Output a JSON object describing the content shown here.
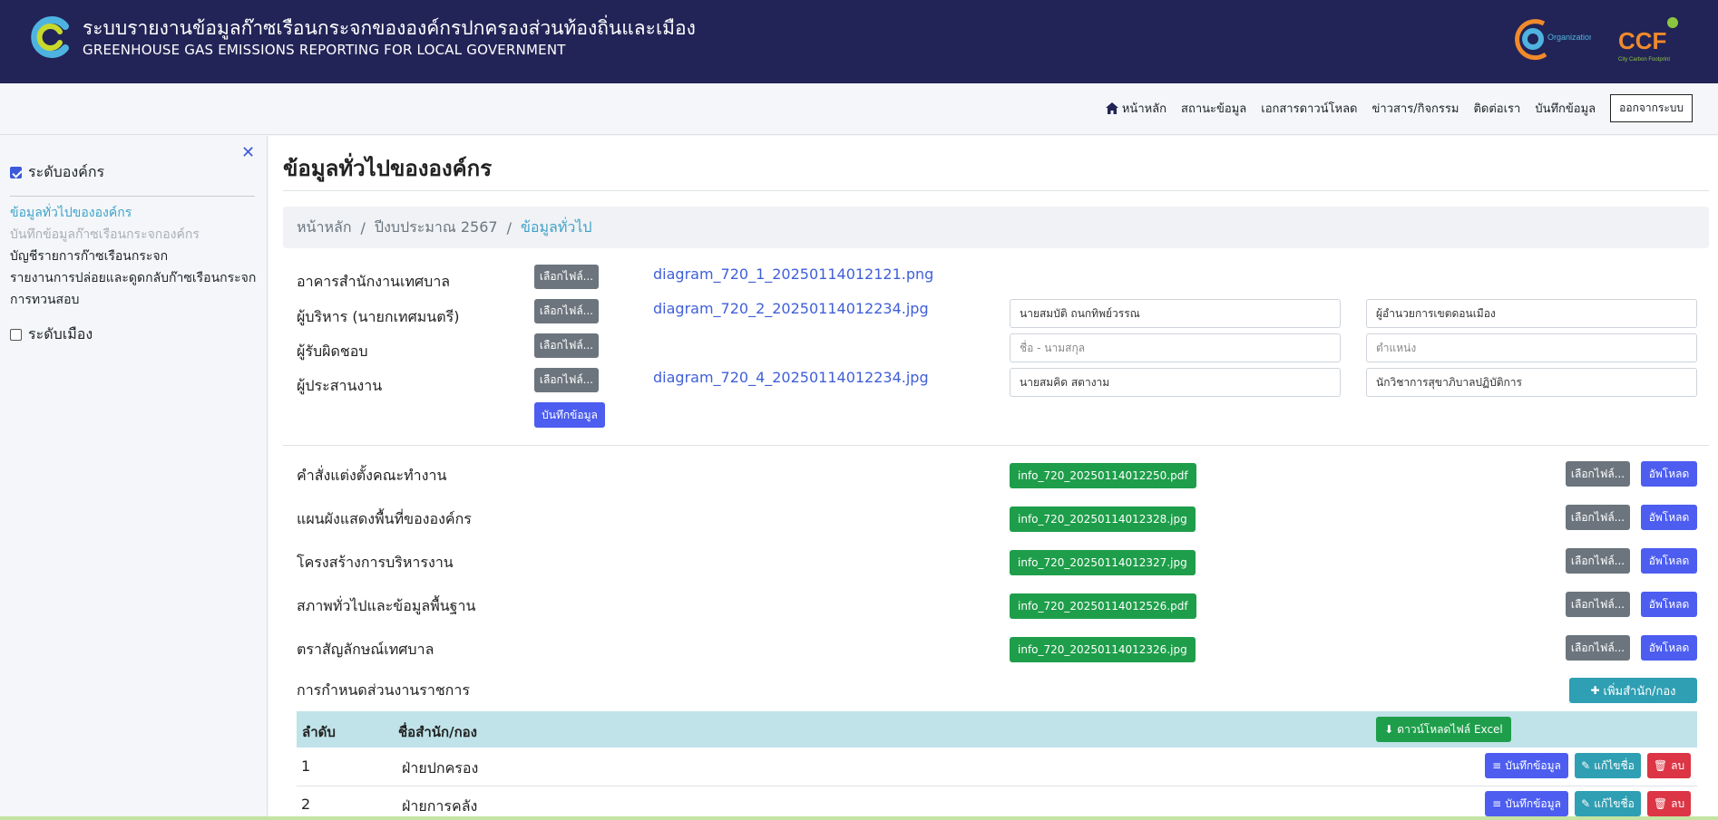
{
  "header": {
    "title_th": "ระบบรายงานข้อมูลก๊าซเรือนกระจกขององค์กรปกครองส่วนท้องถิ่นและเมือง",
    "title_en": "GREENHOUSE GAS EMISSIONS REPORTING FOR LOCAL GOVERNMENT",
    "logo_org_text": "Organization",
    "logo_ccf_text": "CCF",
    "logo_ccf_sub": "City Carbon Footprint"
  },
  "nav": {
    "home": "หน้าหลัก",
    "status": "สถานะข้อมูล",
    "downloads": "เอกสารดาวน์โหลด",
    "news": "ข่าวสาร/กิจกรรม",
    "contact": "ติดต่อเรา",
    "record": "บันทึกข้อมูล",
    "logout": "ออกจากระบบ"
  },
  "sidebar": {
    "org_level": "ระดับองค์กร",
    "city_level": "ระดับเมือง",
    "menu": [
      "ข้อมูลทั่วไปขององค์กร",
      "บันทึกข้อมูลก๊าซเรือนกระจกองค์กร",
      "บัญชีรายการก๊าซเรือนกระจก",
      "รายงานการปล่อยและดูดกลับก๊าซเรือนกระจก",
      "การทวนสอบ"
    ]
  },
  "main": {
    "title": "ข้อมูลทั่วไปขององค์กร",
    "breadcrumb": [
      "หน้าหลัก",
      "ปีงบประมาณ 2567",
      "ข้อมูลทั่วไป"
    ],
    "choose_file": "เลือกไฟล์...",
    "save": "บันทึกข้อมูล",
    "upload": "อัพโหลด",
    "images": [
      {
        "label": "อาคารสำนักงานเทศบาล",
        "file": "diagram_720_1_20250114012121.png",
        "name": "",
        "position": ""
      },
      {
        "label": "ผู้บริหาร (นายกเทศมนตรี)",
        "file": "diagram_720_2_20250114012234.jpg",
        "name": "นายสมบัติ ถนกทิพย์วรรณ",
        "position": "ผู้อำนวยการเขตดอนเมือง"
      },
      {
        "label": "ผู้รับผิดชอบ",
        "file": "",
        "name_placeholder": "ชื่อ - นามสกุล",
        "position_placeholder": "ตำแหน่ง"
      },
      {
        "label": "ผู้ประสานงาน",
        "file": "diagram_720_4_20250114012234.jpg",
        "name": "นายสมคิด สตางาม",
        "position": "นักวิชาการสุขาภิบาลปฏิบัติการ"
      }
    ],
    "docs": [
      {
        "label": "คำสั่งแต่งตั้งคณะทำงาน",
        "file": "info_720_20250114012250.pdf"
      },
      {
        "label": "แผนผังแสดงพื้นที่ขององค์กร",
        "file": "info_720_20250114012328.jpg"
      },
      {
        "label": "โครงสร้างการบริหารงาน",
        "file": "info_720_20250114012327.jpg"
      },
      {
        "label": "สภาพทั่วไปและข้อมูลพื้นฐาน",
        "file": "info_720_20250114012526.pdf"
      },
      {
        "label": "ตราสัญลักษณ์เทศบาล",
        "file": "info_720_20250114012326.jpg"
      }
    ],
    "units_label": "การกำหนดส่วนงานราชการ",
    "add_unit": "เพิ่มสำนัก/กอง",
    "download_excel": "ดาวน์โหลดไฟล์ Excel",
    "table_headers": [
      "ลำดับ",
      "ชื่อสำนัก/กอง"
    ],
    "rows": [
      {
        "no": "1",
        "name": "ฝ่ายปกครอง"
      },
      {
        "no": "2",
        "name": "ฝ่ายการคลัง"
      }
    ],
    "row_save": "บันทึกข้อมูล",
    "row_edit": "แก้ไขชื่อ",
    "row_delete": "ลบ"
  }
}
